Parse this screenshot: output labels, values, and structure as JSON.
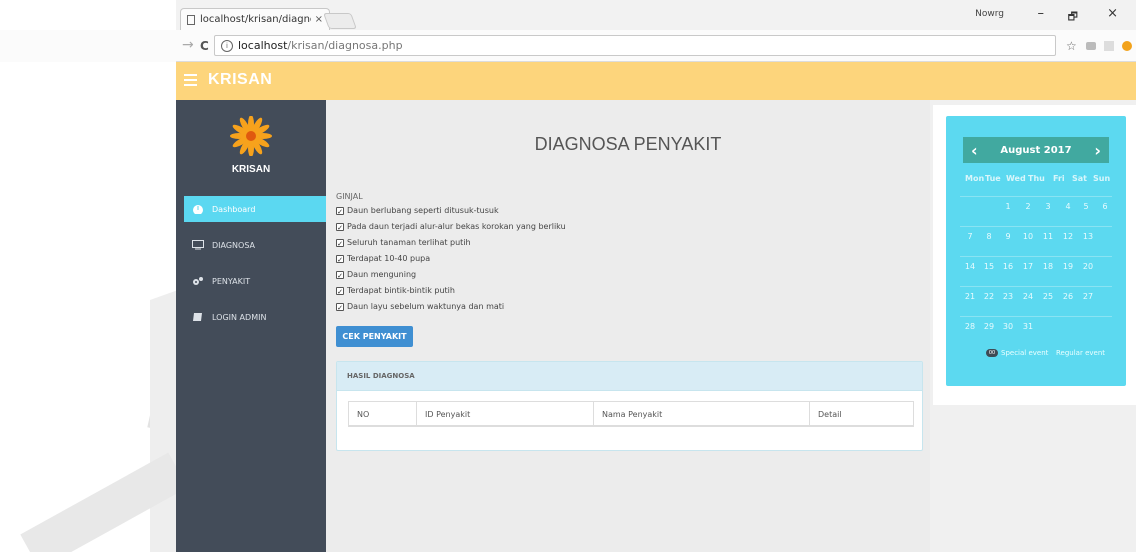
{
  "browser": {
    "tab_title": "localhost/krisan/diagnos",
    "tab_close": "×",
    "url_host": "localhost",
    "url_path": "/krisan/diagnosa.php",
    "user_label": "Nowrg",
    "minimize": "–",
    "restore": "🗗",
    "close": "×",
    "back": "←",
    "forward": "→",
    "reload": "C",
    "star": "☆"
  },
  "header": {
    "brand": "KRISAN"
  },
  "sidebar": {
    "brand": "KRISAN",
    "items": [
      {
        "label": "Dashboard",
        "icon": "dashboard-icon"
      },
      {
        "label": "DIAGNOSA",
        "icon": "monitor-icon"
      },
      {
        "label": "PENYAKIT",
        "icon": "gears-icon"
      },
      {
        "label": "LOGIN ADMIN",
        "icon": "book-icon"
      }
    ]
  },
  "main": {
    "title": "DIAGNOSA PENYAKIT",
    "category": "GINJAL",
    "symptoms": [
      "Daun berlubang seperti ditusuk-tusuk",
      "Pada daun terjadi alur-alur bekas korokan yang berliku",
      "Seluruh tanaman terlihat putih",
      "Terdapat 10-40 pupa",
      "Daun menguning",
      "Terdapat bintik-bintik putih",
      "Daun layu sebelum waktunya dan mati"
    ],
    "button": "CEK PENYAKIT",
    "result_title": "HASIL DIAGNOSA",
    "table_headers": [
      "NO",
      "ID Penyakit",
      "Nama Penyakit",
      "Detail"
    ]
  },
  "calendar": {
    "month": "August 2017",
    "prev": "‹",
    "next": "›",
    "days_of_week": [
      "Mon",
      "Tue",
      "Wed",
      "Thu",
      "Fri",
      "Sat",
      "Sun"
    ],
    "weeks": [
      [
        "",
        "1",
        "2",
        "3",
        "4",
        "5",
        "6"
      ],
      [
        "7",
        "8",
        "9",
        "10",
        "11",
        "12",
        "13"
      ],
      [
        "14",
        "15",
        "16",
        "17",
        "18",
        "19",
        "20"
      ],
      [
        "21",
        "22",
        "23",
        "24",
        "25",
        "26",
        "27"
      ],
      [
        "28",
        "29",
        "30",
        "31",
        "",
        "",
        ""
      ]
    ],
    "badge": "00",
    "legend_special": "Special event",
    "legend_regular": "Regular event"
  }
}
